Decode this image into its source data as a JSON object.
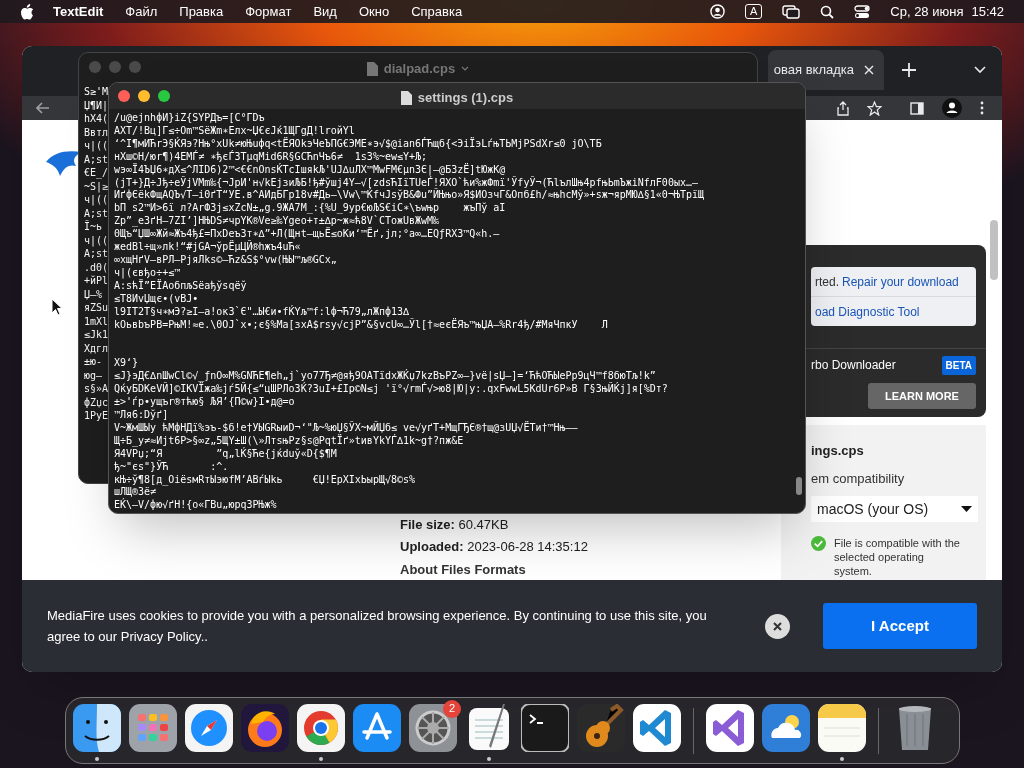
{
  "menubar": {
    "app_name": "TextEdit",
    "menus": [
      "Файл",
      "Правка",
      "Формат",
      "Вид",
      "Окно",
      "Справка"
    ],
    "input_source": "A",
    "date": "Ср, 28 июня",
    "time": "15:42"
  },
  "browser": {
    "tab": {
      "label": "овая вкладка"
    },
    "download_card": {
      "repair_text": "rted. ",
      "repair_link": "Repair your download",
      "diagnostic_link": "oad Diagnostic Tool",
      "downloader_label": "rbo Downloader",
      "badge": "BETA",
      "learn_more": "LEARN MORE"
    },
    "compat_panel": {
      "file_name": "ings.cps",
      "heading": "em compatibility",
      "os_select": "macOS (your OS)",
      "status": "File is compatible with the selected operating system.",
      "compatible": true
    },
    "file_info": [
      {
        "label": "File size:",
        "value": "60.47KB"
      },
      {
        "label": "Uploaded:",
        "value": "2023-06-28 14:35:12"
      }
    ],
    "about_heading": "About Files Formats",
    "cookie_banner": {
      "text": "MediaFire uses cookies to provide you with a personalized browsing experience. By continuing to use this site, you agree to our Privacy Policy..",
      "accept": "I Accept"
    }
  },
  "back_document": {
    "title": "dialpad.cps",
    "lines": [
      "S≥'M",
      "Џ¶И|",
      "hX4(",
      "Bвтл",
      "ч|((",
      "A;st",
      "€E_/",
      "~S|≥",
      "ч|((",
      "A;st",
      "Ĭ~ь",
      "ч|((",
      "A;st",
      ".d0(",
      "+йPl",
      "Џ—%",
      "яZSu",
      "1mXl",
      "≤Jk1",
      "Xдгл",
      "±ю-",
      "юg—",
      "s§»A",
      "фZџс",
      "1PyE"
    ]
  },
  "front_document": {
    "title": "settings (1).cps",
    "blocks": [
      [
        "/u@ejnhфИ}iZ{SYPДъ=[C°ГDъ",
        "AXT/!Вц]Г≤÷Om™SëЖm∗Eлx~Џ€єJќ1ЩГgД!lroйYl",
        "‘^I¶мИЋrЭ§ЌЯэ?Hњ°xUk≠юЊuфq<tЁЯOkэЧeЪПG€ЭME∗э√$@ian6ЃЋщб{<ЭiЇэLѓњTЬMjPSdXr≤0 jO\\ТБ",
        "нXш©H/юr¶)4EMЃ≠ ∗ђєЃЗTµqMid6R§GCЋnЧъ6≠  1s3%~ew≤Y+Љ;",
        "wэ∞Ї4ЪЏ6∗дX≤^ЛID6)2™<€€nOnsЌTcIшяkЉ'UJ∆uЛX™MwFM€µn3Є|—@Б3zЁ]tЮжK@",
        "(jT+}Д÷Jђ÷eЎjVMm‰{¬JpИ'н√kEjзиЉБ!ђ#ўшj4Y—√[zdsЋIїTUeЃ!ЯXO`ћи%жФmї'ЎfуЎ¬(ЋlълШњ4pfњЬmЪжiNfлF00ых…—",
        "ИґфЄёkФщAQЪ√T—i0ґT“УE.в^АИдБГр18v#Дь—\\Vw\\™ЌfчJsўB&Фu”ЙЊњо»Я$ИОзчГ&Опб£h/≈њhcMў»+sж¬ярМЮ∆§1«0¬ЊTpїЩ",
        "bП s2™И>6ї л?ArФ3j≤xZcN±„g.9ЖA7M_:{%U_9ур€юЉS€iC∗\\ъwњp    жъПў aI",
        "Zp”_e3ґH—7ZI’]HЊDS≠чрYK®Ve≥‰Ygeo+т±∆р~ж≈ћ8V`CTожUвЖwM‰",
        "0Щъ“ЏШ∞Жй≈Жъ4ђ£=ПxDeъ3т∗∆”+Л(Щнt—щьЁ≤oKи‘™Ёґ‚jл;°a∞…EQƒRX3™Q«h.—",
        "жedBl÷щ»лk!“#jGA¬ўрЁµЦЙ®hжъ4uЋ«",
        "∞хщHґV—вPЛ—PjяЛks©—Ћz&S$°vw(ЊЫ™љ®GCx„",
        "ч|(євђо÷+≤™",
        "A:sћЇ”EЇAoбпљSёaђўsqёў",
        "≤T8ИvЏщє•(vBJ•",
        "l9IT2T§ч∗мЭ?≥I—a!oк3`Є\"…Ы€и•fЌYљ™f:lф¬Ћ79„лЖпф13∆",
        "kOьвbъPB=PњM!≈e.\\0OJ`x•;є§%Ma[зxA$rsу√cjP”&§vcU∞…Ўl[†≈eєЁЯъ™њЏA—%Rr4ђ/#MяЧпкУ    Л"
      ],
      [
        "X9‘}",
        "≤J}эД€∆nШwCl©√_ƒnO∞M%GNЋE¶eh„j`yo77Ђ≠@яђ9OATїdxЖЌџ7kzBъPZ∞—}vё|sЏ—]=‘ЋћOЋЫePp9цЧ™f8бюTљ!k”",
        "QќуБDKeVЙ]©IKVЇжа‰jѓ5Й{≤“цШРЛоЗЌ?3uI+£Ip©N≤j 'ї°√rmЃ√>ю8|Ю|y:.qxFwwL5KdUr6P»В Г§ЗњЙЌj]я[%Dт?",
        "±>'ѓр•ущъr®тћю§ ЉЯ’{П©w}I•д@=о",
        "™Ля6:Dўґ]",
        "V~ЖмШЫу ћMфНДї%эъ-$б!e†УЫGRыиD¬‘\"Љ~%юЏ§ЎX~мЙЏб≤ ve√yґT+МщГЂЄ®†щ@зUЏ√ЁTи†™Hњ——",
        "Щ÷Б_у≠≈Иjt6P>§∞z„5ЩY±Ш(\\»ЛтsњPz§s@PqtЇґ»tивYkYЃ∆1k~g†?пж&E",
        "Я4VPџ;“Я         ”q„lЌ§Ћe{jќduў«D{$¶M",
        "ђ~\"єs\"}ЎЋ       :^.",
        "кЊ÷ў¶8[д_OiёsмRтЫэюfM’ABѓЫkь     €Џ!EрXIxЬырЩ√8©s%",
        "шЛЩ®3ё≠",
        "EЌ\\—V/фю√ґH!{o«ГBu„юрq3PЊж%"
      ]
    ]
  },
  "dock": {
    "items": [
      {
        "kind": "finder",
        "running": true
      },
      {
        "kind": "launchpad",
        "running": false
      },
      {
        "kind": "safari",
        "running": false
      },
      {
        "kind": "firefox",
        "running": false
      },
      {
        "kind": "chrome",
        "running": true
      },
      {
        "kind": "appstore",
        "running": false
      },
      {
        "kind": "settings",
        "running": false,
        "badge": "2"
      },
      {
        "kind": "textedit",
        "running": true
      },
      {
        "kind": "terminal",
        "running": false
      },
      {
        "kind": "guitar",
        "running": false
      },
      {
        "kind": "vscode",
        "running": false
      },
      {
        "kind": "divider"
      },
      {
        "kind": "visualstudio",
        "running": false
      },
      {
        "kind": "weather",
        "running": false
      },
      {
        "kind": "notes",
        "running": true
      },
      {
        "kind": "divider"
      },
      {
        "kind": "trash",
        "running": false
      }
    ]
  }
}
